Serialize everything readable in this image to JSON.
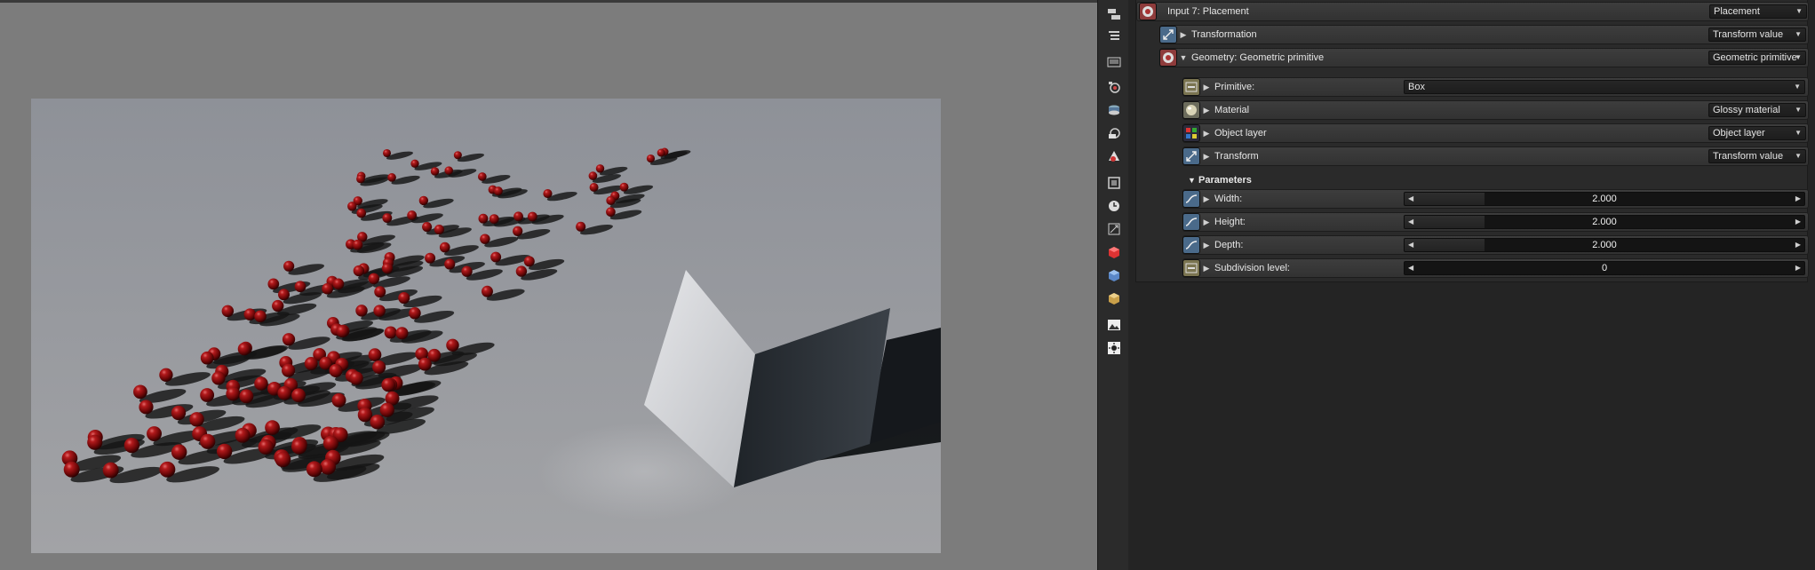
{
  "viewport": {
    "scene": "rendered-scene"
  },
  "toolbar": {
    "buttons": [
      "graph-editor-icon",
      "outliner-icon",
      "image-icon",
      "camera-icon",
      "stack-icon",
      "layers-icon",
      "material-icon",
      "frame-icon",
      "clock-icon",
      "transform-icon",
      "red-cube-icon",
      "blue-cube-icon",
      "gold-cube-icon",
      "picture-icon",
      "sun-icon"
    ]
  },
  "inspector": {
    "header": {
      "label": "Input 7: Placement",
      "value": "Placement"
    },
    "transformation": {
      "label": "Transformation",
      "value": "Transform value"
    },
    "geometry": {
      "label": "Geometry: Geometric primitive",
      "value": "Geometric primitive"
    },
    "primitive": {
      "label": "Primitive:",
      "value": "Box"
    },
    "material": {
      "label": "Material",
      "value": "Glossy material"
    },
    "object_layer": {
      "label": "Object layer",
      "value": "Object layer"
    },
    "transform": {
      "label": "Transform",
      "value": "Transform value"
    },
    "parameters": {
      "title": "Parameters",
      "width": {
        "label": "Width:",
        "value": "2.000",
        "fill": 0.2
      },
      "height": {
        "label": "Height:",
        "value": "2.000",
        "fill": 0.2
      },
      "depth": {
        "label": "Depth:",
        "value": "2.000",
        "fill": 0.2
      },
      "subdivision": {
        "label": "Subdivision level:",
        "value": "0",
        "fill": 0.0
      }
    }
  },
  "colors": {
    "accent": "#4a6a8a",
    "sphere": "#8e0d10",
    "panel": "#2a2a2a"
  }
}
